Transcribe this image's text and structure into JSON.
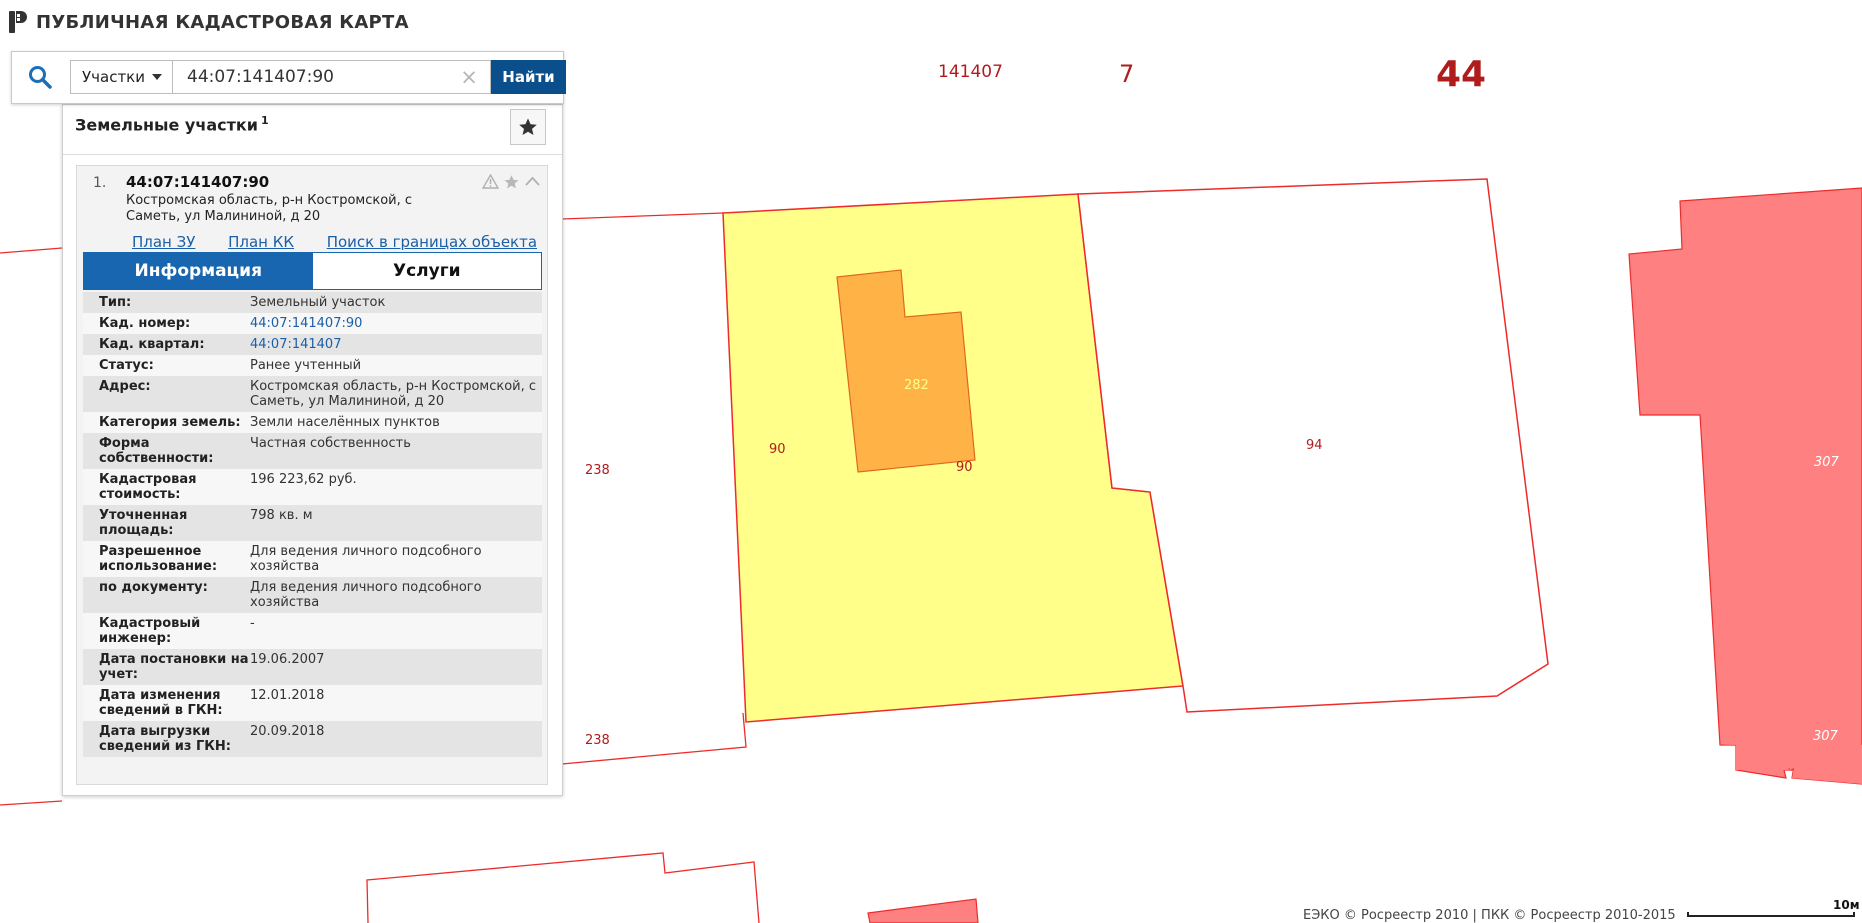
{
  "app": {
    "title": "ПУБЛИЧНАЯ КАДАСТРОВАЯ КАРТА"
  },
  "search": {
    "type_label": "Участки",
    "query": "44:07:141407:90",
    "find_label": "Найти",
    "clear_glyph": "×"
  },
  "panel": {
    "title": "Земельные участки",
    "count": "1",
    "result": {
      "num": "1.",
      "code": "44:07:141407:90",
      "address": "Костромская область, р-н Костромской, с Саметь, ул Малининой, д 20",
      "links": [
        "План ЗУ →",
        "План КК →",
        "Поиск в границах объекта →"
      ]
    },
    "tabs": [
      "Информация",
      "Услуги"
    ],
    "info": [
      {
        "label": "Тип:",
        "value": "Земельный участок"
      },
      {
        "label": "Кад. номер:",
        "value": "44:07:141407:90"
      },
      {
        "label": "Кад. квартал:",
        "value": "44:07:141407"
      },
      {
        "label": "Статус:",
        "value": "Ранее учтенный"
      },
      {
        "label": "Адрес:",
        "value": "Костромская область, р-н Костромской, с Саметь, ул Малининой, д 20"
      },
      {
        "label": "Категория земель:",
        "value": "Земли населённых пунктов"
      },
      {
        "label": "Форма собственности:",
        "value": "Частная собственность"
      },
      {
        "label": "Кадастровая стоимость:",
        "value": "196 223,62 руб."
      },
      {
        "label": "Уточненная площадь:",
        "value": "798 кв. м"
      },
      {
        "label": "Разрешенное использование:",
        "value": "Для ведения личного подсобного хозяйства"
      },
      {
        "label": "по документу:",
        "value": "Для ведения личного подсобного хозяйства"
      },
      {
        "label": "Кадастровый инженер:",
        "value": "-"
      },
      {
        "label": "Дата постановки на учет:",
        "value": "19.06.2007"
      },
      {
        "label": "Дата изменения сведений в ГКН:",
        "value": "12.01.2018"
      },
      {
        "label": "Дата выгрузки сведений из ГКН:",
        "value": "20.09.2018"
      }
    ]
  },
  "map": {
    "block_labels": [
      "141407",
      "7",
      "44"
    ],
    "parcel_labels": [
      "238",
      "238",
      "90",
      "90",
      "282",
      "94",
      "307",
      "307"
    ],
    "colors": {
      "boundary": "#ee2b2b",
      "selected_fill": "#ffff8a",
      "building_fill": "#ffb347",
      "capital_fill": "#ff8080",
      "label": "#b01c1c"
    }
  },
  "footer": {
    "credit": "ЕЭКО © Росреестр 2010 | ПКК © Росреестр 2010-2015",
    "scale": "10м"
  }
}
